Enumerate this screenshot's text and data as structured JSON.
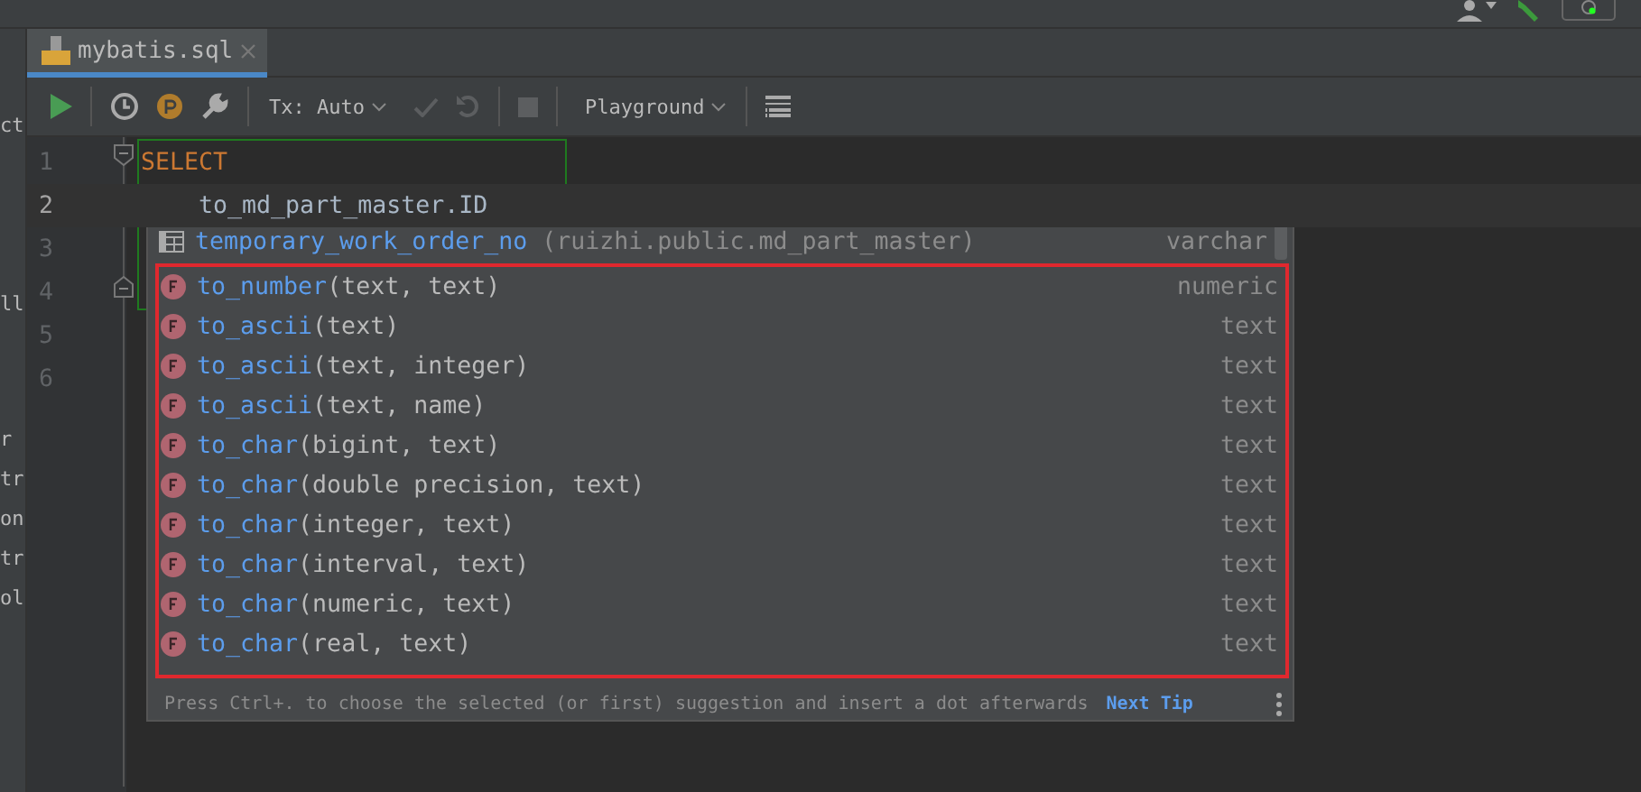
{
  "left_panel": {
    "fragments": [
      "ct",
      "ll",
      "r",
      "tr",
      "on",
      "tr",
      "ol"
    ]
  },
  "tab": {
    "label": "mybatis.sql",
    "selected": true
  },
  "toolbar": {
    "tx": "Tx: Auto",
    "session": "Playground"
  },
  "editor": {
    "lines": [
      {
        "number": "1",
        "code": "SELECT",
        "kind": "keyword",
        "current": false
      },
      {
        "number": "2",
        "code": "    to_md_part_master.ID",
        "kind": "plain",
        "current": true
      },
      {
        "number": "3",
        "current": false
      },
      {
        "number": "4",
        "current": false
      },
      {
        "number": "5",
        "current": false
      },
      {
        "number": "6",
        "current": false
      }
    ]
  },
  "completion": {
    "header": {
      "name": "temporary_work_order_no",
      "source": "(ruizhi.public.md_part_master)",
      "type": "varchar"
    },
    "items": [
      {
        "name": "to_number",
        "args": "(text, text)",
        "type": "numeric"
      },
      {
        "name": "to_ascii",
        "args": "(text)",
        "type": "text"
      },
      {
        "name": "to_ascii",
        "args": "(text, integer)",
        "type": "text"
      },
      {
        "name": "to_ascii",
        "args": "(text, name)",
        "type": "text"
      },
      {
        "name": "to_char",
        "args": "(bigint, text)",
        "type": "text"
      },
      {
        "name": "to_char",
        "args": "(double precision, text)",
        "type": "text"
      },
      {
        "name": "to_char",
        "args": "(integer, text)",
        "type": "text"
      },
      {
        "name": "to_char",
        "args": "(interval, text)",
        "type": "text"
      },
      {
        "name": "to_char",
        "args": "(numeric, text)",
        "type": "text"
      },
      {
        "name": "to_char",
        "args": "(real, text)",
        "type": "text"
      }
    ],
    "hint": "Press Ctrl+. to choose the selected (or first) suggestion and insert a dot afterwards",
    "next_tip": "Next Tip"
  }
}
